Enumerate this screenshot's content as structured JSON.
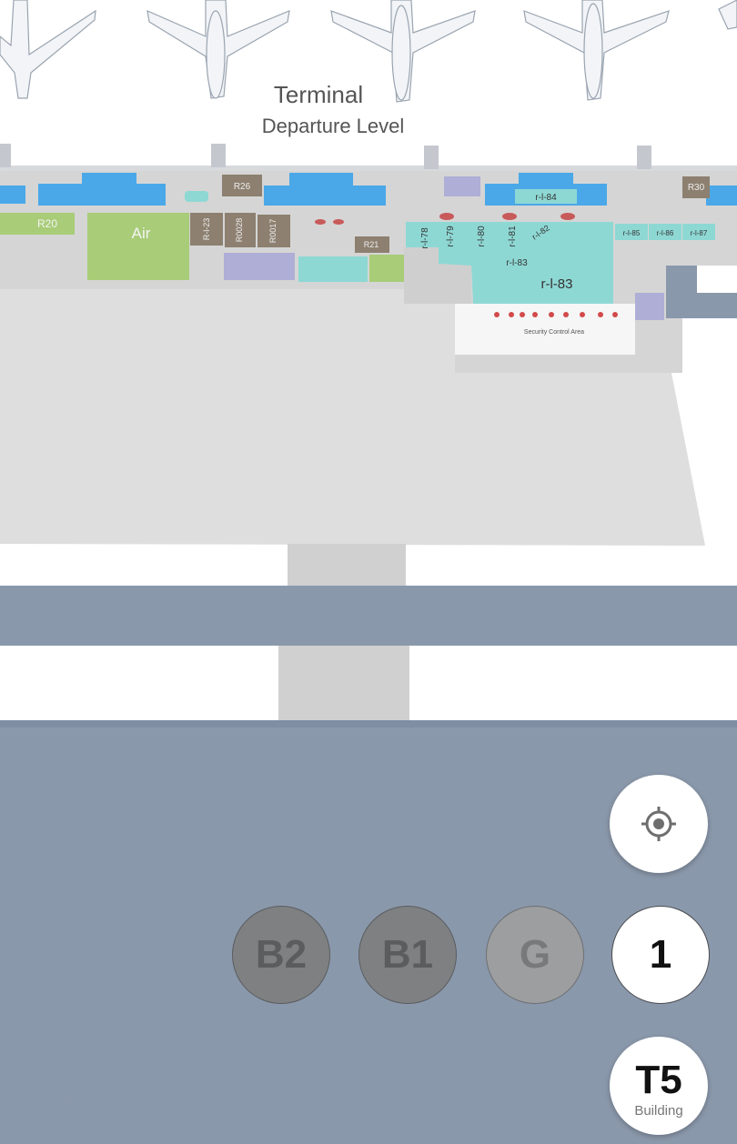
{
  "map": {
    "header_title": "Terminal",
    "header_subtitle": "Departure Level",
    "rooms": {
      "r20": "R20",
      "air": "Air",
      "rl23": "R-l-23",
      "r0028": "R0028",
      "r0017": "R0017",
      "r26": "R26",
      "r21": "R21",
      "r30": "R30",
      "rl84": "r-l-84",
      "rl78": "r-l-78",
      "rl79": "r-l-79",
      "rl80": "r-l-80",
      "rl81": "r-l-81",
      "rl82": "r-l-82",
      "rl83_small": "r-l-83",
      "rl83": "r-l-83",
      "rl85": "r-l-85",
      "rl86": "r-l-86",
      "rl87": "r-l-87"
    },
    "security_label": "Security Control Area",
    "colors": {
      "gate_blue": "#4aa8e8",
      "teal_zone": "#8ed8d4",
      "green_zone": "#a8cc78",
      "brown_room": "#8d8070",
      "lavender_room": "#aeaed6",
      "floor_grey": "#dcdcdc",
      "road_grey": "#8a98ab"
    }
  },
  "controls": {
    "locate_icon": "crosshair-icon",
    "floors": [
      {
        "label": "B2",
        "selected": false
      },
      {
        "label": "B1",
        "selected": false
      },
      {
        "label": "G",
        "selected": false
      },
      {
        "label": "1",
        "selected": true
      }
    ],
    "building": {
      "code": "T5",
      "label": "Building"
    }
  }
}
